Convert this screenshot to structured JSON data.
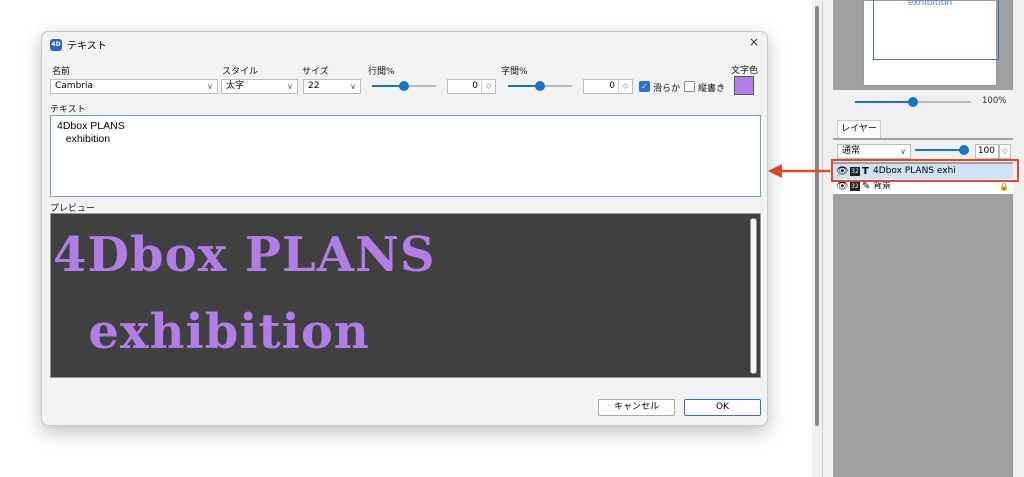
{
  "dialog": {
    "title_icon": "4D",
    "title": "テキスト",
    "close": "×",
    "font_label": "名前",
    "font_value": "Cambria",
    "style_label": "スタイル",
    "style_value": "太字",
    "size_label": "サイズ",
    "size_value": "22",
    "line_spacing_label": "行間%",
    "line_spacing_value": "0",
    "line_spacing_level": 0.5,
    "char_spacing_label": "字間%",
    "char_spacing_value": "0",
    "char_spacing_level": 0.5,
    "smooth_label": "滑らか",
    "smooth_checked": true,
    "vertical_label": "縦書き",
    "vertical_checked": false,
    "text_color_label": "文字色",
    "text_color": "#b07ee6",
    "text_label": "テキスト",
    "text_value": "4Dbox PLANS\n   exhibition",
    "preview_label": "プレビュー",
    "preview_text": "4Dbox PLANS\n  exhibition",
    "cancel_label": "キャンセル",
    "ok_label": "OK"
  },
  "panel": {
    "nav_text": "exhibition",
    "zoom": "100%",
    "zoom_level": 0.5,
    "layers_tab": "レイヤー",
    "blend_mode": "通常",
    "opacity": "100",
    "layers": [
      {
        "bits": "32",
        "kind": "T",
        "name": "4Dbox PLANS exhi",
        "selected": true
      },
      {
        "bits": "32",
        "kind": "✎",
        "name": "背景",
        "locked": true
      }
    ]
  },
  "colors": {
    "accent": "#2a6fd6",
    "highlight": "#e04a28",
    "preview_bg": "#404040"
  }
}
